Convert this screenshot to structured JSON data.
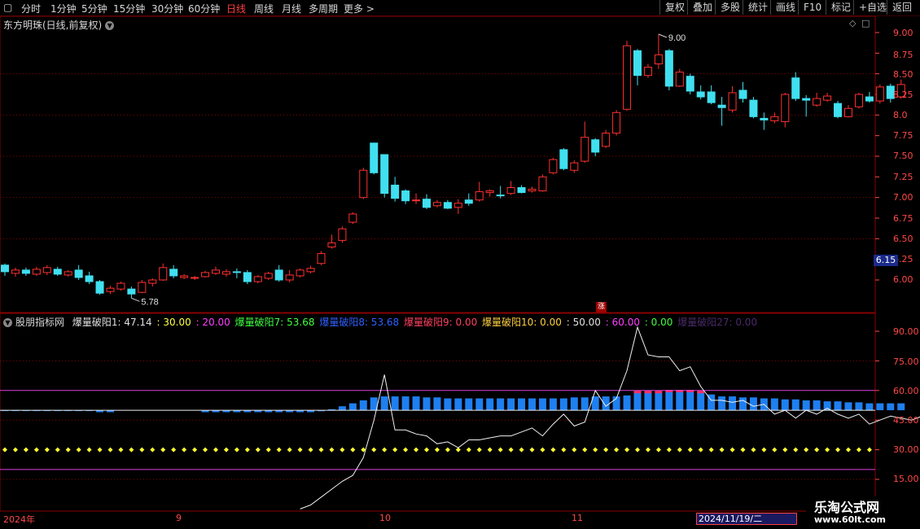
{
  "toolbar": {
    "periods": [
      "分时",
      "1分钟",
      "5分钟",
      "15分钟",
      "30分钟",
      "60分钟",
      "日线",
      "周线",
      "月线",
      "多周期",
      "更多 >"
    ],
    "active_period": "日线",
    "right_buttons": [
      "复权",
      "叠加",
      "多股",
      "统计",
      "画线",
      "F10",
      "标记",
      "+自选",
      "返回"
    ]
  },
  "main_chart": {
    "title": "东方明珠(日线,前复权)",
    "high_label": "9.00",
    "low_label": "5.78",
    "price_tag": "6.15",
    "yaxis_ticks": [
      "9.00",
      "8.75",
      "8.50",
      "8.25",
      "8.0",
      "7.75",
      "7.50",
      "7.25",
      "7.00",
      "6.75",
      "6.50",
      "6.25",
      "6.00"
    ],
    "event_badge": "涨"
  },
  "indicator": {
    "name": "股朋指标网",
    "items": [
      {
        "text": "爆量破阳1: 47.14",
        "color": "#e0e0e0"
      },
      {
        "text": ": 30.00",
        "color": "#ffff40"
      },
      {
        "text": ": 20.00",
        "color": "#ff40ff"
      },
      {
        "text": "爆量破阳7: 53.68",
        "color": "#40ff40"
      },
      {
        "text": "爆量破阳8: 53.68",
        "color": "#3060ff"
      },
      {
        "text": "爆量破阳9: 0.00",
        "color": "#ff4060"
      },
      {
        "text": "爆量破阳10: 0.00",
        "color": "#ffd040"
      },
      {
        "text": ": 50.00",
        "color": "#e0e0e0"
      },
      {
        "text": ": 60.00",
        "color": "#ff40ff"
      },
      {
        "text": ": 0.00",
        "color": "#40ff40"
      },
      {
        "text": "爆量破阳27: 0.00",
        "color": "#4a2a6a"
      }
    ],
    "yaxis_ticks": [
      "90.00",
      "75.00",
      "60.00",
      "45.00",
      "30.00",
      "15.00"
    ]
  },
  "xaxis": {
    "labels": [
      "2024年",
      "9",
      "10",
      "11"
    ],
    "cursor_date": "2024/11/19/二"
  },
  "watermark": {
    "title": "乐淘公式网",
    "url": "www.60lt.com"
  },
  "colors": {
    "up": "#ff3030",
    "down": "#40e0f0",
    "bar": "#1e7ff0",
    "grid": "#8a0000"
  },
  "chart_data": {
    "type": "candlestick",
    "title": "东方明珠(日线,前复权)",
    "ylim": [
      5.6,
      9.2
    ],
    "candles": [
      [
        6.18,
        6.1,
        6.2,
        6.05
      ],
      [
        6.08,
        6.12,
        6.15,
        6.04
      ],
      [
        6.12,
        6.08,
        6.15,
        6.05
      ],
      [
        6.07,
        6.13,
        6.16,
        6.05
      ],
      [
        6.09,
        6.15,
        6.18,
        6.06
      ],
      [
        6.13,
        6.07,
        6.16,
        6.05
      ],
      [
        6.06,
        6.1,
        6.12,
        6.04
      ],
      [
        6.12,
        6.03,
        6.18,
        6.0
      ],
      [
        6.05,
        5.98,
        6.1,
        5.95
      ],
      [
        5.98,
        5.84,
        6.0,
        5.82
      ],
      [
        5.86,
        5.9,
        5.93,
        5.83
      ],
      [
        5.89,
        5.96,
        5.98,
        5.87
      ],
      [
        5.89,
        5.83,
        5.92,
        5.78
      ],
      [
        5.85,
        5.97,
        6.0,
        5.84
      ],
      [
        5.96,
        6.0,
        6.02,
        5.92
      ],
      [
        6.0,
        6.15,
        6.2,
        5.99
      ],
      [
        6.13,
        6.05,
        6.18,
        6.02
      ],
      [
        6.03,
        6.05,
        6.07,
        6.01
      ],
      [
        6.02,
        6.03,
        6.05,
        6.0
      ],
      [
        6.04,
        6.09,
        6.11,
        6.03
      ],
      [
        6.08,
        6.12,
        6.16,
        6.06
      ],
      [
        6.07,
        6.1,
        6.13,
        6.04
      ],
      [
        6.1,
        6.09,
        6.14,
        6.02
      ],
      [
        6.09,
        5.98,
        6.12,
        5.95
      ],
      [
        5.98,
        6.04,
        6.06,
        5.96
      ],
      [
        6.02,
        6.08,
        6.1,
        6.0
      ],
      [
        6.12,
        6.0,
        6.18,
        5.98
      ],
      [
        6.0,
        6.06,
        6.12,
        5.97
      ],
      [
        6.05,
        6.12,
        6.14,
        6.03
      ],
      [
        6.1,
        6.14,
        6.17,
        6.08
      ],
      [
        6.2,
        6.32,
        6.35,
        6.18
      ],
      [
        6.4,
        6.45,
        6.55,
        6.38
      ],
      [
        6.48,
        6.62,
        6.65,
        6.45
      ],
      [
        6.7,
        6.8,
        6.82,
        6.68
      ],
      [
        7.0,
        7.33,
        7.36,
        6.98
      ],
      [
        7.66,
        7.3,
        7.66,
        7.28
      ],
      [
        7.52,
        7.05,
        7.52,
        7.0
      ],
      [
        7.15,
        6.99,
        7.25,
        6.95
      ],
      [
        7.08,
        6.96,
        7.1,
        6.92
      ],
      [
        6.96,
        6.97,
        7.05,
        6.92
      ],
      [
        6.98,
        6.88,
        7.04,
        6.86
      ],
      [
        6.9,
        6.94,
        6.97,
        6.88
      ],
      [
        6.94,
        6.87,
        6.97,
        6.86
      ],
      [
        6.88,
        6.93,
        6.98,
        6.8
      ],
      [
        6.97,
        6.93,
        7.05,
        6.9
      ],
      [
        6.97,
        7.07,
        7.19,
        6.95
      ],
      [
        7.06,
        7.08,
        7.1,
        7.01
      ],
      [
        7.03,
        7.02,
        7.14,
        6.99
      ],
      [
        7.05,
        7.12,
        7.2,
        7.03
      ],
      [
        7.12,
        7.06,
        7.15,
        7.05
      ],
      [
        7.08,
        7.1,
        7.13,
        7.06
      ],
      [
        7.08,
        7.25,
        7.28,
        7.07
      ],
      [
        7.3,
        7.46,
        7.48,
        7.28
      ],
      [
        7.58,
        7.35,
        7.6,
        7.33
      ],
      [
        7.33,
        7.42,
        7.45,
        7.3
      ],
      [
        7.44,
        7.73,
        7.92,
        7.42
      ],
      [
        7.7,
        7.55,
        7.72,
        7.5
      ],
      [
        7.62,
        7.78,
        7.82,
        7.6
      ],
      [
        7.78,
        8.03,
        8.06,
        7.75
      ],
      [
        8.07,
        8.84,
        8.9,
        8.05
      ],
      [
        8.78,
        8.48,
        8.8,
        8.36
      ],
      [
        8.48,
        8.58,
        8.62,
        8.45
      ],
      [
        8.62,
        8.73,
        8.98,
        8.56
      ],
      [
        8.78,
        8.35,
        8.8,
        8.3
      ],
      [
        8.35,
        8.52,
        8.56,
        8.34
      ],
      [
        8.47,
        8.29,
        8.5,
        8.25
      ],
      [
        8.28,
        8.22,
        8.36,
        8.19
      ],
      [
        8.28,
        8.15,
        8.36,
        8.13
      ],
      [
        8.12,
        8.09,
        8.22,
        7.87
      ],
      [
        8.06,
        8.27,
        8.35,
        8.03
      ],
      [
        8.3,
        8.2,
        8.4,
        8.15
      ],
      [
        8.18,
        7.98,
        8.22,
        7.96
      ],
      [
        7.96,
        7.94,
        8.03,
        7.82
      ],
      [
        7.93,
        7.98,
        8.03,
        7.9
      ],
      [
        7.92,
        8.25,
        8.27,
        7.85
      ],
      [
        8.45,
        8.2,
        8.52,
        8.17
      ],
      [
        8.2,
        8.18,
        8.24,
        7.98
      ],
      [
        8.12,
        8.2,
        8.27,
        8.1
      ],
      [
        8.18,
        8.23,
        8.27,
        8.16
      ],
      [
        8.14,
        7.98,
        8.17,
        7.96
      ],
      [
        7.98,
        8.08,
        8.12,
        7.97
      ],
      [
        8.1,
        8.25,
        8.27,
        8.08
      ],
      [
        8.22,
        8.17,
        8.28,
        8.15
      ],
      [
        8.17,
        8.34,
        8.37,
        8.14
      ],
      [
        8.35,
        8.2,
        8.38,
        8.15
      ],
      [
        8.22,
        8.37,
        8.43,
        8.2
      ]
    ],
    "indicator_line": [
      null,
      null,
      null,
      null,
      null,
      null,
      null,
      null,
      null,
      null,
      null,
      null,
      null,
      null,
      null,
      null,
      null,
      null,
      null,
      null,
      null,
      null,
      null,
      null,
      null,
      null,
      null,
      null,
      0,
      2,
      6,
      10,
      14,
      17,
      26,
      45,
      68,
      40,
      40,
      38,
      37,
      33,
      34,
      31,
      35,
      35,
      36,
      37,
      37,
      39,
      41,
      37,
      43,
      48,
      42,
      44,
      60,
      52,
      56,
      70,
      92,
      78,
      77,
      77,
      70,
      72,
      62,
      55,
      55,
      54,
      55,
      52,
      53,
      48,
      50,
      46,
      50,
      48,
      51,
      48,
      46,
      48,
      43,
      45,
      47,
      46,
      45,
      47
    ],
    "bars": [
      50,
      50,
      50,
      50,
      50,
      50,
      50,
      50,
      50,
      49,
      49,
      null,
      null,
      null,
      null,
      null,
      null,
      null,
      null,
      49,
      49,
      49,
      49,
      49,
      49,
      49,
      49,
      49,
      49,
      49,
      49.5,
      50.5,
      52,
      53.5,
      55,
      56.5,
      57,
      57,
      57,
      57,
      56.5,
      56.5,
      56,
      56,
      56,
      56,
      56,
      56,
      56,
      56,
      56,
      56,
      56,
      56,
      56.5,
      56.5,
      57,
      57,
      57,
      57.5,
      59,
      59,
      59,
      59.5,
      59.5,
      59.5,
      59,
      58,
      57,
      57,
      56.5,
      56.5,
      56,
      56,
      55.5,
      55.5,
      55,
      55,
      54.5,
      54.5,
      54,
      54,
      53.5,
      53.5,
      53.5,
      53.5
    ],
    "reference_lines": {
      "yellow_dots": 30,
      "magenta_upper": 60,
      "magenta_lower": 20,
      "white": 50
    },
    "indicator_ylim": [
      10,
      95
    ]
  }
}
